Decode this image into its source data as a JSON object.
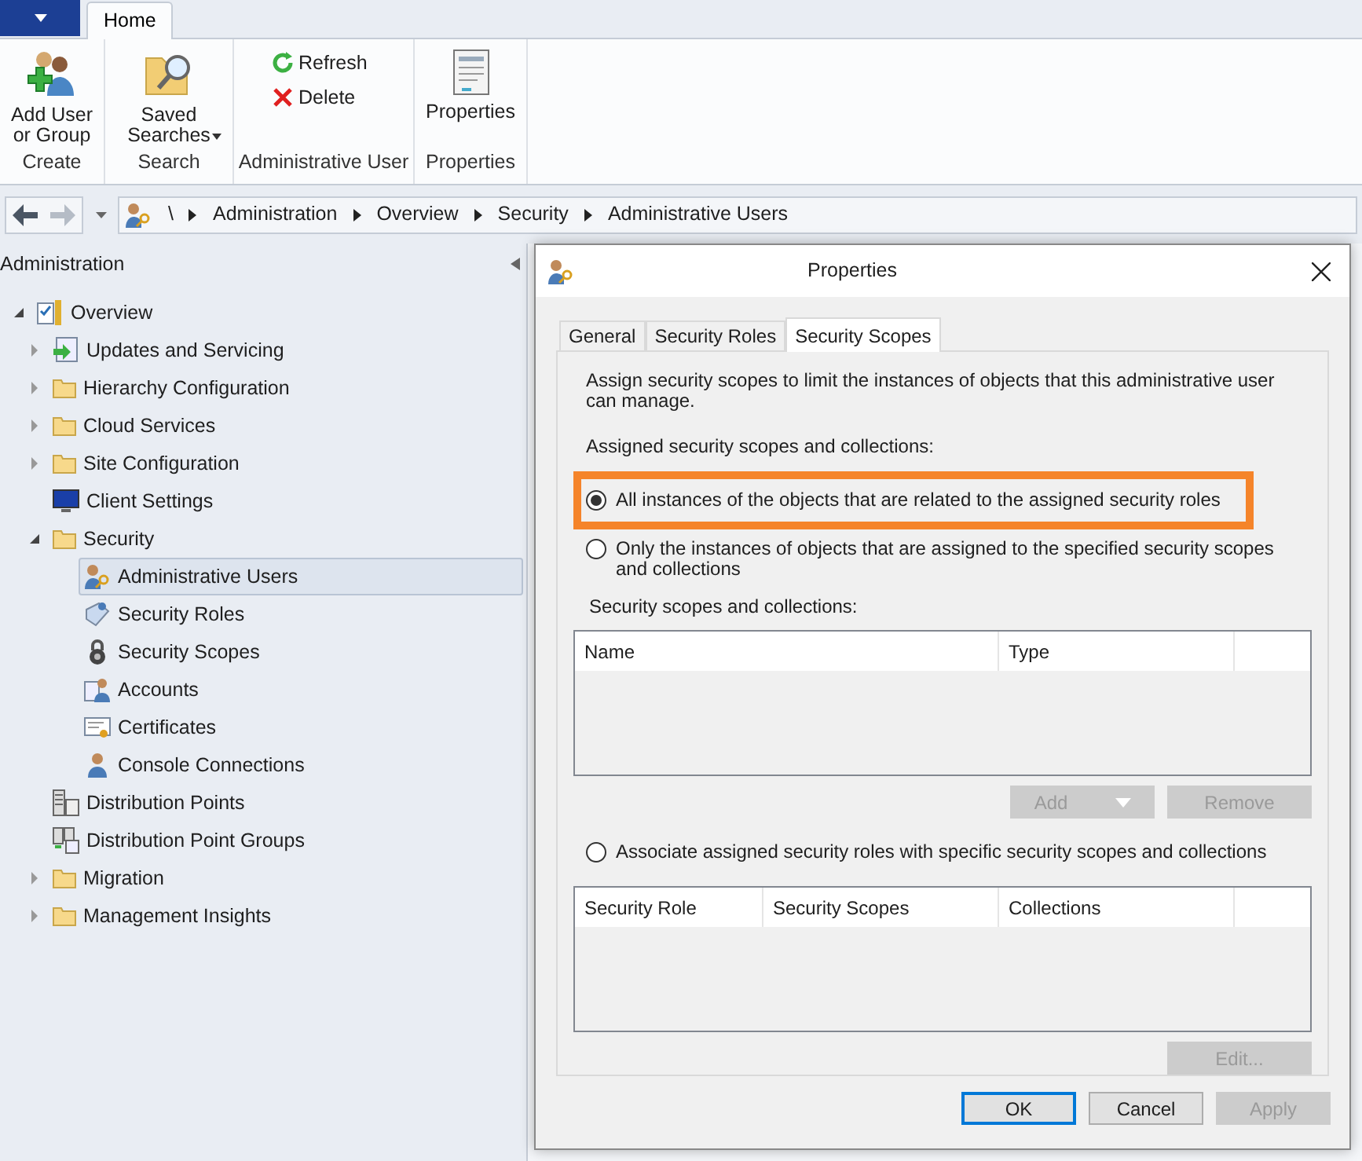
{
  "ribbon": {
    "tabs": [
      {
        "label": "Home",
        "selected": true
      }
    ],
    "groups": [
      {
        "label": "Create",
        "buttons": [
          {
            "label": "Add User or Group",
            "kind": "large-user"
          }
        ]
      },
      {
        "label": "Search",
        "buttons": [
          {
            "label": "Saved Searches",
            "kind": "large-search",
            "dropdown": true
          }
        ]
      },
      {
        "label": "Administrative User",
        "buttons": [
          {
            "label": "Refresh",
            "kind": "small-refresh"
          },
          {
            "label": "Delete",
            "kind": "small-delete"
          }
        ]
      },
      {
        "label": "Properties",
        "buttons": [
          {
            "label": "Properties",
            "kind": "large-properties"
          }
        ]
      }
    ]
  },
  "address_bar": {
    "path": [
      "\\",
      "Administration",
      "Overview",
      "Security",
      "Administrative Users"
    ]
  },
  "navigation": {
    "title": "Administration",
    "tree": [
      {
        "label": "Overview",
        "kind": "overview",
        "expanded": true,
        "selected": false,
        "children": [
          {
            "label": "Updates and Servicing",
            "kind": "updates",
            "expanded": false,
            "selected": false
          },
          {
            "label": "Hierarchy Configuration",
            "kind": "folder",
            "expanded": false,
            "selected": false
          },
          {
            "label": "Cloud Services",
            "kind": "folder",
            "expanded": false,
            "selected": false
          },
          {
            "label": "Site Configuration",
            "kind": "folder",
            "expanded": false,
            "selected": false
          },
          {
            "label": "Client Settings",
            "kind": "monitor",
            "selected": false
          },
          {
            "label": "Security",
            "kind": "folder",
            "expanded": true,
            "selected": false,
            "children": [
              {
                "label": "Administrative Users",
                "kind": "admin-user",
                "selected": true
              },
              {
                "label": "Security Roles",
                "kind": "roles",
                "selected": false
              },
              {
                "label": "Security Scopes",
                "kind": "lock",
                "selected": false
              },
              {
                "label": "Accounts",
                "kind": "accounts",
                "selected": false
              },
              {
                "label": "Certificates",
                "kind": "certificate",
                "selected": false
              },
              {
                "label": "Console Connections",
                "kind": "person",
                "selected": false
              }
            ]
          },
          {
            "label": "Distribution Points",
            "kind": "server",
            "selected": false
          },
          {
            "label": "Distribution Point Groups",
            "kind": "server-group",
            "selected": false
          },
          {
            "label": "Migration",
            "kind": "folder",
            "expanded": false,
            "selected": false
          },
          {
            "label": "Management Insights",
            "kind": "folder",
            "expanded": false,
            "selected": false
          }
        ]
      }
    ]
  },
  "dialog": {
    "title": "Properties",
    "tabs": [
      {
        "label": "General",
        "selected": false
      },
      {
        "label": "Security Roles",
        "selected": false
      },
      {
        "label": "Security Scopes",
        "selected": true
      }
    ],
    "description": "Assign security scopes to limit the instances of objects that  this administrative user can manage.",
    "section_label": "Assigned security scopes and collections:",
    "options": [
      {
        "label": "All instances of the objects that are related to the assigned security roles",
        "selected": true,
        "highlighted": true
      },
      {
        "label": "Only the instances of objects  that are assigned to the specified security scopes and collections",
        "selected": false,
        "highlighted": false
      }
    ],
    "scopes_label": "Security scopes and collections:",
    "scopes_table": {
      "columns": [
        "Name",
        "Type"
      ]
    },
    "scopes_buttons": [
      {
        "label": "Add",
        "disabled": true,
        "dropdown": true
      },
      {
        "label": "Remove",
        "disabled": true
      }
    ],
    "associate_option": {
      "label": "Associate assigned security roles with specific security scopes and collections",
      "selected": false
    },
    "roles_table": {
      "columns": [
        "Security Role",
        "Security Scopes",
        "Collections"
      ]
    },
    "roles_buttons": [
      {
        "label": "Edit...",
        "disabled": true
      }
    ],
    "footer_buttons": [
      {
        "label": "OK",
        "disabled": false,
        "default": true
      },
      {
        "label": "Cancel",
        "disabled": false,
        "default": false
      },
      {
        "label": "Apply",
        "disabled": true,
        "default": false
      }
    ]
  }
}
